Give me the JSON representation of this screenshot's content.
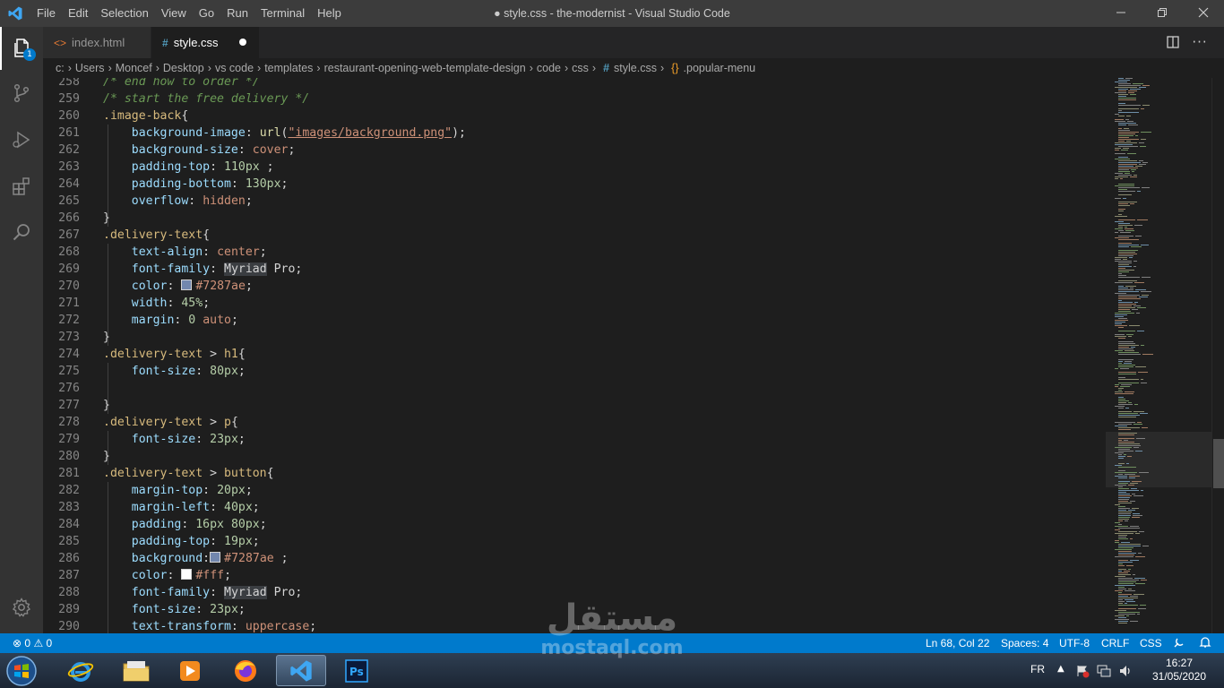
{
  "window": {
    "title": "● style.css - the-modernist - Visual Studio Code",
    "menu": [
      "File",
      "Edit",
      "Selection",
      "View",
      "Go",
      "Run",
      "Terminal",
      "Help"
    ]
  },
  "activity": {
    "badge": "1"
  },
  "tabs": [
    {
      "label": "index.html",
      "icon": "html-icon"
    },
    {
      "label": "style.css",
      "icon": "hash-icon",
      "modified": true
    }
  ],
  "breadcrumb": [
    "c:",
    "Users",
    "Moncef",
    "Desktop",
    "vs code",
    "templates",
    "restaurant-opening-web-template-design",
    "code",
    "css",
    "style.css",
    ".popular-menu"
  ],
  "editor": {
    "lines": [
      {
        "n": "258",
        "t": [
          [
            "c-com",
            "/* end how to order */"
          ]
        ]
      },
      {
        "n": "259",
        "t": [
          [
            "c-com",
            "/* start the free delivery */"
          ]
        ]
      },
      {
        "n": "260",
        "t": [
          [
            "c-sel",
            ".image-back"
          ],
          [
            "c-p",
            "{"
          ]
        ]
      },
      {
        "n": "261",
        "t": [
          [
            "c-p",
            "    "
          ],
          [
            "c-prop",
            "background-image"
          ],
          [
            "c-p",
            ": "
          ],
          [
            "c-fn",
            "url"
          ],
          [
            "c-p",
            "("
          ],
          [
            "c-str",
            "\"images/background.png\""
          ],
          [
            "c-p",
            ");"
          ]
        ]
      },
      {
        "n": "262",
        "t": [
          [
            "c-p",
            "    "
          ],
          [
            "c-prop",
            "background-size"
          ],
          [
            "c-p",
            ": "
          ],
          [
            "c-val",
            "cover"
          ],
          [
            "c-p",
            ";"
          ]
        ]
      },
      {
        "n": "263",
        "t": [
          [
            "c-p",
            "    "
          ],
          [
            "c-prop",
            "padding-top"
          ],
          [
            "c-p",
            ": "
          ],
          [
            "c-num",
            "110px"
          ],
          [
            "c-p",
            " ;"
          ]
        ]
      },
      {
        "n": "264",
        "t": [
          [
            "c-p",
            "    "
          ],
          [
            "c-prop",
            "padding-bottom"
          ],
          [
            "c-p",
            ": "
          ],
          [
            "c-num",
            "130px"
          ],
          [
            "c-p",
            ";"
          ]
        ]
      },
      {
        "n": "265",
        "t": [
          [
            "c-p",
            "    "
          ],
          [
            "c-prop",
            "overflow"
          ],
          [
            "c-p",
            ": "
          ],
          [
            "c-val",
            "hidden"
          ],
          [
            "c-p",
            ";"
          ]
        ]
      },
      {
        "n": "266",
        "t": [
          [
            "c-p",
            "}"
          ]
        ]
      },
      {
        "n": "267",
        "t": [
          [
            "c-sel",
            ".delivery-text"
          ],
          [
            "c-p",
            "{"
          ]
        ]
      },
      {
        "n": "268",
        "t": [
          [
            "c-p",
            "    "
          ],
          [
            "c-prop",
            "text-align"
          ],
          [
            "c-p",
            ": "
          ],
          [
            "c-val",
            "center"
          ],
          [
            "c-p",
            ";"
          ]
        ]
      },
      {
        "n": "269",
        "t": [
          [
            "c-p",
            "    "
          ],
          [
            "c-prop",
            "font-family"
          ],
          [
            "c-p",
            ": "
          ],
          [
            "c-hl",
            "Myriad"
          ],
          [
            "c-p",
            " Pro;"
          ]
        ]
      },
      {
        "n": "270",
        "t": [
          [
            "c-p",
            "    "
          ],
          [
            "c-prop",
            "color"
          ],
          [
            "c-p",
            ": "
          ],
          [
            "sw",
            "#7287ae"
          ],
          [
            "c-val",
            "#7287ae"
          ],
          [
            "c-p",
            ";"
          ]
        ]
      },
      {
        "n": "271",
        "t": [
          [
            "c-p",
            "    "
          ],
          [
            "c-prop",
            "width"
          ],
          [
            "c-p",
            ": "
          ],
          [
            "c-num",
            "45%"
          ],
          [
            "c-p",
            ";"
          ]
        ]
      },
      {
        "n": "272",
        "t": [
          [
            "c-p",
            "    "
          ],
          [
            "c-prop",
            "margin"
          ],
          [
            "c-p",
            ": "
          ],
          [
            "c-num",
            "0"
          ],
          [
            "c-p",
            " "
          ],
          [
            "c-val",
            "auto"
          ],
          [
            "c-p",
            ";"
          ]
        ]
      },
      {
        "n": "273",
        "t": [
          [
            "c-p",
            "}"
          ]
        ]
      },
      {
        "n": "274",
        "t": [
          [
            "c-sel",
            ".delivery-text"
          ],
          [
            "c-p",
            " > "
          ],
          [
            "c-sel",
            "h1"
          ],
          [
            "c-p",
            "{"
          ]
        ]
      },
      {
        "n": "275",
        "t": [
          [
            "c-p",
            "    "
          ],
          [
            "c-prop",
            "font-size"
          ],
          [
            "c-p",
            ": "
          ],
          [
            "c-num",
            "80px"
          ],
          [
            "c-p",
            ";"
          ]
        ]
      },
      {
        "n": "276",
        "t": []
      },
      {
        "n": "277",
        "t": [
          [
            "c-p",
            "}"
          ]
        ]
      },
      {
        "n": "278",
        "t": [
          [
            "c-sel",
            ".delivery-text"
          ],
          [
            "c-p",
            " > "
          ],
          [
            "c-sel",
            "p"
          ],
          [
            "c-p",
            "{"
          ]
        ]
      },
      {
        "n": "279",
        "t": [
          [
            "c-p",
            "    "
          ],
          [
            "c-prop",
            "font-size"
          ],
          [
            "c-p",
            ": "
          ],
          [
            "c-num",
            "23px"
          ],
          [
            "c-p",
            ";"
          ]
        ]
      },
      {
        "n": "280",
        "t": [
          [
            "c-p",
            "}"
          ]
        ]
      },
      {
        "n": "281",
        "t": [
          [
            "c-sel",
            ".delivery-text"
          ],
          [
            "c-p",
            " > "
          ],
          [
            "c-sel",
            "button"
          ],
          [
            "c-p",
            "{"
          ]
        ]
      },
      {
        "n": "282",
        "t": [
          [
            "c-p",
            "    "
          ],
          [
            "c-prop",
            "margin-top"
          ],
          [
            "c-p",
            ": "
          ],
          [
            "c-num",
            "20px"
          ],
          [
            "c-p",
            ";"
          ]
        ]
      },
      {
        "n": "283",
        "t": [
          [
            "c-p",
            "    "
          ],
          [
            "c-prop",
            "margin-left"
          ],
          [
            "c-p",
            ": "
          ],
          [
            "c-num",
            "40px"
          ],
          [
            "c-p",
            ";"
          ]
        ]
      },
      {
        "n": "284",
        "t": [
          [
            "c-p",
            "    "
          ],
          [
            "c-prop",
            "padding"
          ],
          [
            "c-p",
            ": "
          ],
          [
            "c-num",
            "16px"
          ],
          [
            "c-p",
            " "
          ],
          [
            "c-num",
            "80px"
          ],
          [
            "c-p",
            ";"
          ]
        ]
      },
      {
        "n": "285",
        "t": [
          [
            "c-p",
            "    "
          ],
          [
            "c-prop",
            "padding-top"
          ],
          [
            "c-p",
            ": "
          ],
          [
            "c-num",
            "19px"
          ],
          [
            "c-p",
            ";"
          ]
        ]
      },
      {
        "n": "286",
        "t": [
          [
            "c-p",
            "    "
          ],
          [
            "c-prop",
            "background"
          ],
          [
            "c-p",
            ":"
          ],
          [
            "sw",
            "#7287ae"
          ],
          [
            "c-val",
            "#7287ae"
          ],
          [
            "c-p",
            " ;"
          ]
        ]
      },
      {
        "n": "287",
        "t": [
          [
            "c-p",
            "    "
          ],
          [
            "c-prop",
            "color"
          ],
          [
            "c-p",
            ": "
          ],
          [
            "sw",
            "#ffffff"
          ],
          [
            "c-val",
            "#fff"
          ],
          [
            "c-p",
            ";"
          ]
        ]
      },
      {
        "n": "288",
        "t": [
          [
            "c-p",
            "    "
          ],
          [
            "c-prop",
            "font-family"
          ],
          [
            "c-p",
            ": "
          ],
          [
            "c-hl",
            "Myriad"
          ],
          [
            "c-p",
            " Pro;"
          ]
        ]
      },
      {
        "n": "289",
        "t": [
          [
            "c-p",
            "    "
          ],
          [
            "c-prop",
            "font-size"
          ],
          [
            "c-p",
            ": "
          ],
          [
            "c-num",
            "23px"
          ],
          [
            "c-p",
            ";"
          ]
        ]
      },
      {
        "n": "290",
        "t": [
          [
            "c-p",
            "    "
          ],
          [
            "c-prop",
            "text-transform"
          ],
          [
            "c-p",
            ": "
          ],
          [
            "c-val",
            "uppercase"
          ],
          [
            "c-p",
            ";"
          ]
        ]
      }
    ]
  },
  "status": {
    "errors": "0",
    "warnings": "0",
    "position": "Ln 68, Col 22",
    "spaces": "Spaces: 4",
    "encoding": "UTF-8",
    "eol": "CRLF",
    "language": "CSS"
  },
  "taskbar": {
    "lang": "FR",
    "time": "16:27",
    "date": "31/05/2020"
  },
  "watermark": {
    "arabic": "مستقل",
    "latin": "mostaql.com"
  },
  "colors": {
    "accent": "#007acc",
    "titlebar": "#3c3c3c",
    "activitybar": "#333333",
    "editor": "#1e1e1e"
  }
}
